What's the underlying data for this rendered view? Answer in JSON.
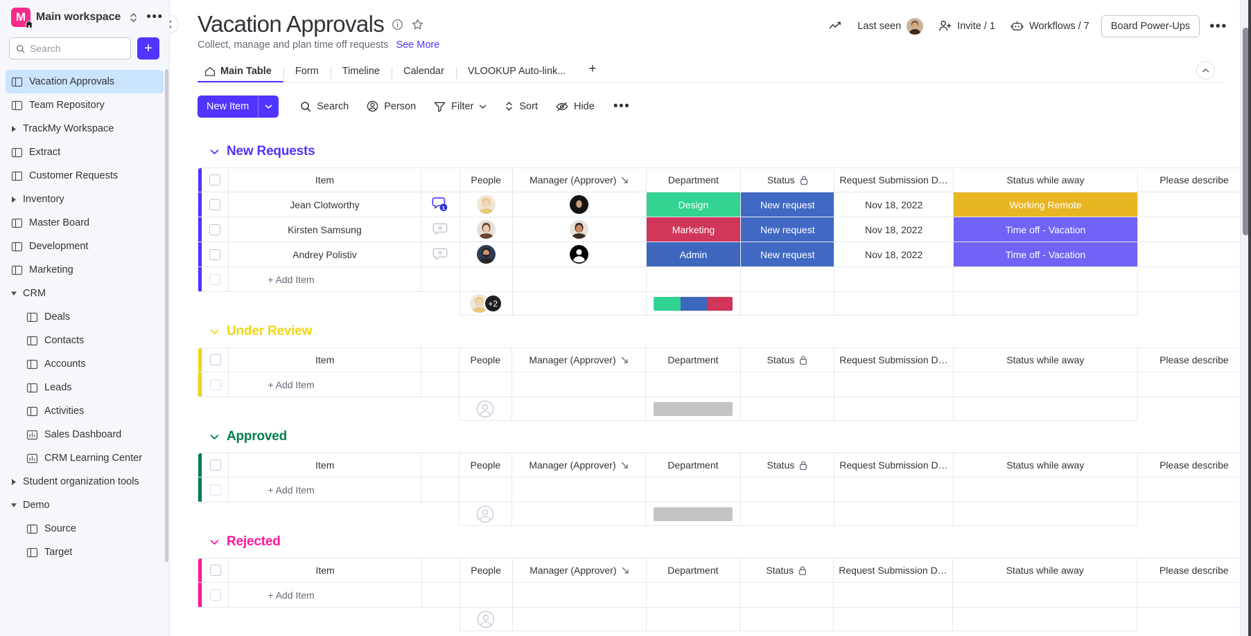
{
  "sidebar": {
    "workspace": {
      "name": "Main workspace",
      "avatar_letter": "M",
      "avatar_color": "#f62b8a"
    },
    "search": {
      "placeholder": "Search",
      "value": ""
    },
    "add_button_label": "+",
    "items": [
      {
        "label": "Vacation Approvals",
        "icon": "board-icon",
        "level": 0,
        "type": "board",
        "selected": true
      },
      {
        "label": "Team Repository",
        "icon": "board-icon",
        "level": 0,
        "type": "board",
        "selected": false
      },
      {
        "label": "TrackMy Workspace",
        "icon": "caret-right-icon",
        "level": 0,
        "type": "folder-collapsed",
        "selected": false
      },
      {
        "label": "Extract",
        "icon": "board-icon",
        "level": 0,
        "type": "board",
        "selected": false
      },
      {
        "label": "Customer Requests",
        "icon": "board-icon",
        "level": 0,
        "type": "board",
        "selected": false
      },
      {
        "label": "Inventory",
        "icon": "caret-right-icon",
        "level": 0,
        "type": "folder-collapsed",
        "selected": false
      },
      {
        "label": "Master Board",
        "icon": "board-icon",
        "level": 0,
        "type": "board",
        "selected": false
      },
      {
        "label": "Development",
        "icon": "board-icon",
        "level": 0,
        "type": "board",
        "selected": false
      },
      {
        "label": "Marketing",
        "icon": "board-icon",
        "level": 0,
        "type": "board",
        "selected": false
      },
      {
        "label": "CRM",
        "icon": "caret-down-icon",
        "level": 0,
        "type": "folder-expanded",
        "selected": false
      },
      {
        "label": "Deals",
        "icon": "board-icon",
        "level": 1,
        "type": "board",
        "selected": false
      },
      {
        "label": "Contacts",
        "icon": "board-icon",
        "level": 1,
        "type": "board",
        "selected": false
      },
      {
        "label": "Accounts",
        "icon": "board-icon",
        "level": 1,
        "type": "board",
        "selected": false
      },
      {
        "label": "Leads",
        "icon": "board-icon",
        "level": 1,
        "type": "board",
        "selected": false
      },
      {
        "label": "Activities",
        "icon": "board-icon",
        "level": 1,
        "type": "board",
        "selected": false
      },
      {
        "label": "Sales Dashboard",
        "icon": "dashboard-icon",
        "level": 1,
        "type": "dashboard",
        "selected": false
      },
      {
        "label": "CRM Learning Center",
        "icon": "dashboard-icon",
        "level": 1,
        "type": "dashboard",
        "selected": false
      },
      {
        "label": "Student organization tools",
        "icon": "caret-right-icon",
        "level": 0,
        "type": "folder-collapsed",
        "selected": false
      },
      {
        "label": "Demo",
        "icon": "caret-down-icon",
        "level": 0,
        "type": "folder-expanded",
        "selected": false
      },
      {
        "label": "Source",
        "icon": "board-icon",
        "level": 1,
        "type": "board",
        "selected": false
      },
      {
        "label": "Target",
        "icon": "board-icon",
        "level": 1,
        "type": "board",
        "selected": false
      }
    ]
  },
  "header": {
    "title": "Vacation Approvals",
    "description": "Collect, manage and plan time off requests",
    "see_more": "See More",
    "last_seen_label": "Last seen",
    "invite_label": "Invite / 1",
    "workflows_label": "Workflows / 7",
    "power_ups_label": "Board Power-Ups",
    "more_label": "•••"
  },
  "tabs": [
    {
      "label": "Main Table",
      "icon": "home-icon",
      "active": true
    },
    {
      "label": "Form",
      "icon": "",
      "active": false
    },
    {
      "label": "Timeline",
      "icon": "",
      "active": false
    },
    {
      "label": "Calendar",
      "icon": "",
      "active": false
    },
    {
      "label": "VLOOKUP Auto-link...",
      "icon": "",
      "active": false
    }
  ],
  "tab_add_label": "+",
  "toolbar": {
    "new_item_label": "New Item",
    "search_label": "Search",
    "person_label": "Person",
    "filter_label": "Filter",
    "sort_label": "Sort",
    "hide_label": "Hide",
    "more_label": "•••"
  },
  "columns": [
    {
      "key": "item",
      "label": "Item"
    },
    {
      "key": "conv",
      "label": ""
    },
    {
      "key": "people",
      "label": "People"
    },
    {
      "key": "manager",
      "label": "Manager (Approver)",
      "icon": "link-arrow-icon"
    },
    {
      "key": "department",
      "label": "Department"
    },
    {
      "key": "status",
      "label": "Status",
      "icon": "lock-icon"
    },
    {
      "key": "submission",
      "label": "Request Submission D…"
    },
    {
      "key": "away",
      "label": "Status while away"
    },
    {
      "key": "describe",
      "label": "Please describe"
    }
  ],
  "groups": [
    {
      "name": "New Requests",
      "color": "#5034ff",
      "add_item_label": "+ Add Item",
      "rows": [
        {
          "item": "Jean Clotworthy",
          "conversation_count": "1",
          "people_avatar": "woman-blonde",
          "manager_avatar": "woman-dark",
          "department": "Design",
          "department_color": "#33d391",
          "status": "New request",
          "status_color": "#4169c4",
          "submission": "Nov 18, 2022",
          "away": "Working Remote",
          "away_color": "#e8b623",
          "describe": ""
        },
        {
          "item": "Kirsten Samsung",
          "conversation_count": "",
          "people_avatar": "woman-brunette",
          "manager_avatar": "man-tan",
          "department": "Marketing",
          "department_color": "#d0365a",
          "status": "New request",
          "status_color": "#4169c4",
          "submission": "Nov 18, 2022",
          "away": "Time off - Vacation",
          "away_color": "#7163f5",
          "describe": ""
        },
        {
          "item": "Andrey Polistiv",
          "conversation_count": "",
          "people_avatar": "man-beard",
          "manager_avatar": "placeholder-person",
          "department": "Admin",
          "department_color": "#3d66bd",
          "status": "New request",
          "status_color": "#4169c4",
          "submission": "Nov 18, 2022",
          "away": "Time off - Vacation",
          "away_color": "#7163f5",
          "describe": ""
        }
      ],
      "summary": {
        "people_extra": "+2",
        "has_people": true,
        "dept_segments": [
          {
            "color": "#33d391",
            "pct": 34
          },
          {
            "color": "#3d66bd",
            "pct": 33
          },
          {
            "color": "#d0365a",
            "pct": 33
          }
        ]
      }
    },
    {
      "name": "Under Review",
      "color": "#f0d714",
      "add_item_label": "+ Add Item",
      "rows": [],
      "summary": {
        "people_extra": "",
        "has_people": false,
        "dept_segments": [
          {
            "color": "#c4c4c4",
            "pct": 100
          }
        ]
      }
    },
    {
      "name": "Approved",
      "color": "#037f4c",
      "add_item_label": "+ Add Item",
      "rows": [],
      "summary": {
        "people_extra": "",
        "has_people": false,
        "dept_segments": [
          {
            "color": "#c4c4c4",
            "pct": 100
          }
        ]
      }
    },
    {
      "name": "Rejected",
      "color": "#ff159c",
      "add_item_label": "+ Add Item",
      "rows": [],
      "summary": {
        "people_extra": "",
        "has_people": false,
        "dept_segments": []
      }
    }
  ]
}
